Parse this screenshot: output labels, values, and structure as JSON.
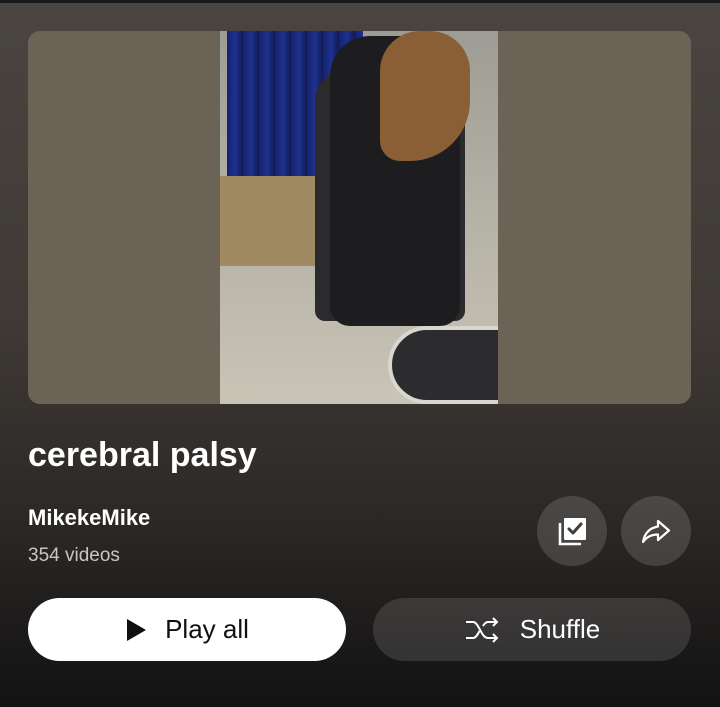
{
  "playlist": {
    "title": "cerebral palsy",
    "channel": "MikekeMike",
    "video_count": "354 videos"
  },
  "actions": {
    "play_all_label": "Play all",
    "shuffle_label": "Shuffle"
  },
  "icons": {
    "save": "playlist-saved-icon",
    "share": "share-icon",
    "play": "play-icon",
    "shuffle": "shuffle-icon"
  },
  "colors": {
    "play_button_bg": "#ffffff",
    "play_button_text": "#0f0f0f",
    "secondary_button_bg": "#3e3b39",
    "text_primary": "#ffffff",
    "text_secondary": "#c9c6c2"
  }
}
